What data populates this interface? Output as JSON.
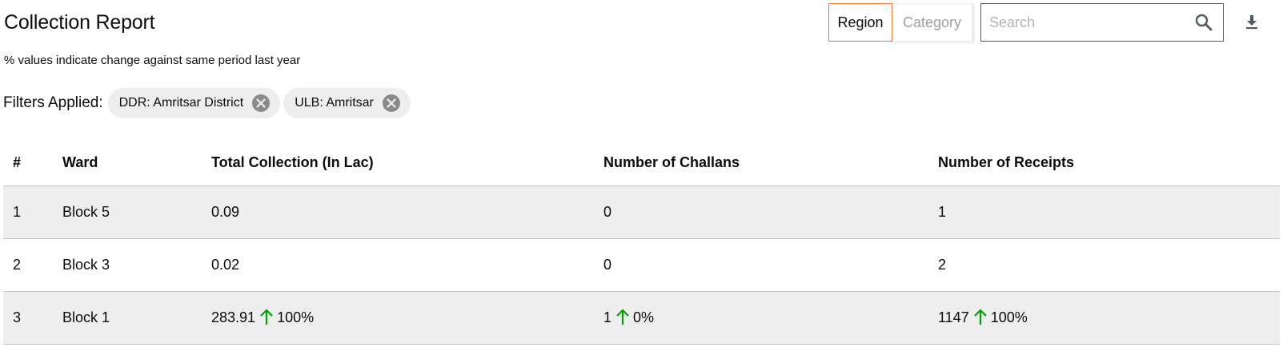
{
  "header": {
    "title": "Collection Report",
    "subtitle": "% values indicate change against same period last year"
  },
  "toggle": {
    "options": [
      {
        "label": "Region",
        "active": true
      },
      {
        "label": "Category",
        "active": false
      }
    ]
  },
  "search": {
    "placeholder": "Search",
    "value": ""
  },
  "filters": {
    "label": "Filters Applied:",
    "chips": [
      {
        "label": "DDR: Amritsar District"
      },
      {
        "label": "ULB: Amritsar"
      }
    ]
  },
  "table": {
    "columns": [
      "#",
      "Ward",
      "Total Collection (In Lac)",
      "Number of Challans",
      "Number of Receipts"
    ],
    "rows": [
      {
        "index": "1",
        "ward": "Block 5",
        "total_collection": {
          "value": "0.09",
          "change": ""
        },
        "challans": {
          "value": "0",
          "change": ""
        },
        "receipts": {
          "value": "1",
          "change": ""
        }
      },
      {
        "index": "2",
        "ward": "Block 3",
        "total_collection": {
          "value": "0.02",
          "change": ""
        },
        "challans": {
          "value": "0",
          "change": ""
        },
        "receipts": {
          "value": "2",
          "change": ""
        }
      },
      {
        "index": "3",
        "ward": "Block 1",
        "total_collection": {
          "value": "283.91",
          "change": "100%"
        },
        "challans": {
          "value": "1",
          "change": "0%"
        },
        "receipts": {
          "value": "1147",
          "change": "100%"
        }
      }
    ]
  },
  "colors": {
    "accent": "#f47738",
    "up_arrow": "#00a000",
    "row_alt": "#eeeeee"
  },
  "icons": {
    "search": "search-icon",
    "download": "download-icon",
    "chip_close": "close-circle-icon",
    "trend_up": "arrow-up-icon"
  }
}
